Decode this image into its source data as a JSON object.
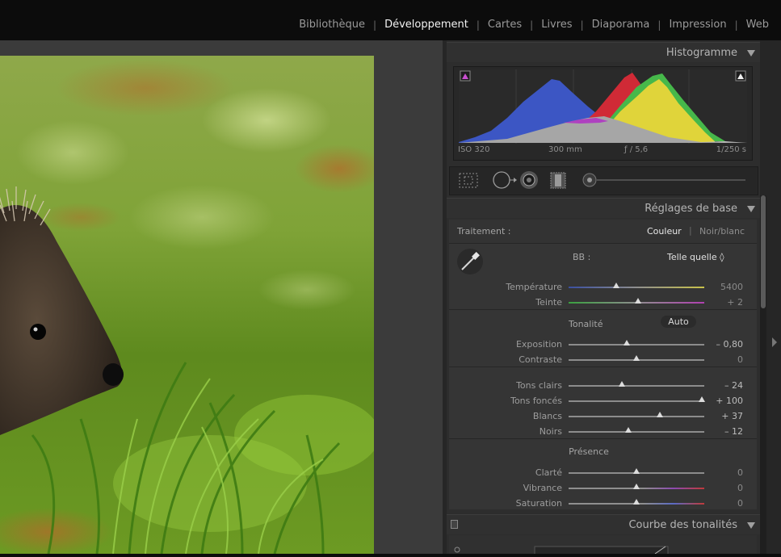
{
  "modules": [
    "Bibliothèque",
    "Développement",
    "Cartes",
    "Livres",
    "Diaporama",
    "Impression",
    "Web"
  ],
  "active_module": "Développement",
  "histogram": {
    "title": "Histogramme",
    "iso": "ISO 320",
    "focal": "300 mm",
    "aperture": "ƒ / 5,6",
    "shutter": "1/250 s"
  },
  "basic": {
    "title": "Réglages de base",
    "treatment_label": "Traitement :",
    "color_option": "Couleur",
    "bw_option": "Noir/blanc",
    "wb_label": "BB :",
    "wb_value": "Telle quelle ◊",
    "tone_label": "Tonalité",
    "auto_label": "Auto",
    "presence_label": "Présence",
    "sliders": [
      {
        "label": "Température",
        "value": "5400",
        "pos": 0.35
      },
      {
        "label": "Teinte",
        "value": "+ 2",
        "pos": 0.51
      },
      {
        "label": "Exposition",
        "value": "– 0,80",
        "pos": 0.43
      },
      {
        "label": "Contraste",
        "value": "0",
        "pos": 0.5
      },
      {
        "label": "Tons clairs",
        "value": "– 24",
        "pos": 0.39
      },
      {
        "label": "Tons foncés",
        "value": "+ 100",
        "pos": 0.98
      },
      {
        "label": "Blancs",
        "value": "+ 37",
        "pos": 0.67
      },
      {
        "label": "Noirs",
        "value": "– 12",
        "pos": 0.44
      },
      {
        "label": "Clarté",
        "value": "0",
        "pos": 0.5
      },
      {
        "label": "Vibrance",
        "value": "0",
        "pos": 0.5
      },
      {
        "label": "Saturation",
        "value": "0",
        "pos": 0.5
      }
    ]
  },
  "curve": {
    "title": "Courbe des tonalités"
  },
  "colors": {
    "active_text": "#f2f2f2",
    "panel_bg": "#353535",
    "accent_temp_left": "#3a4fa0",
    "accent_temp_right": "#c9c24a"
  }
}
